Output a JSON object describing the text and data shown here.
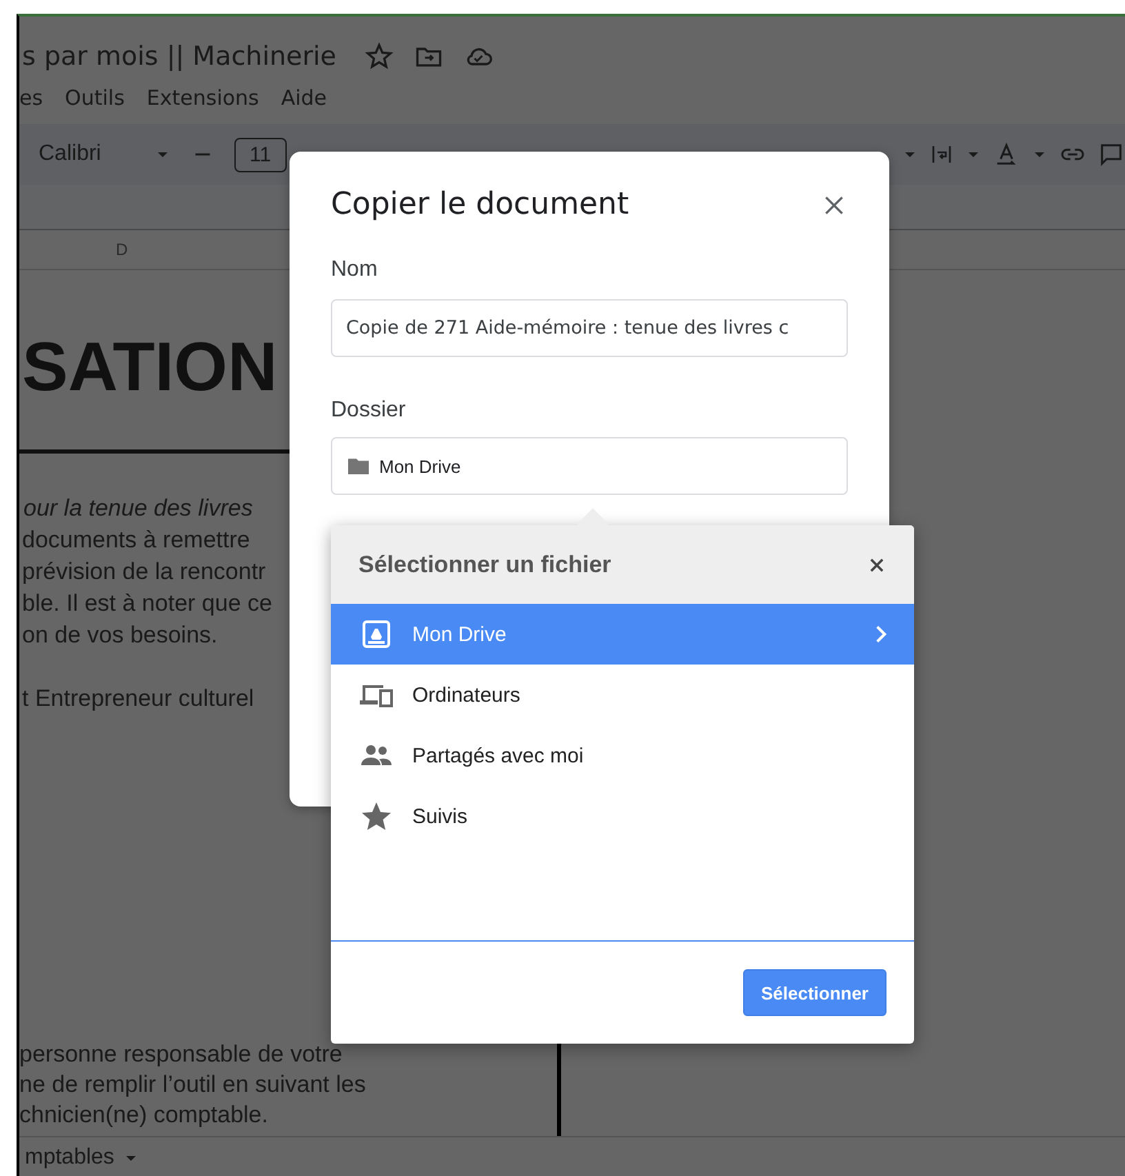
{
  "document": {
    "title": "s par mois || Machinerie",
    "menu": [
      "es",
      "Outils",
      "Extensions",
      "Aide"
    ],
    "toolbar": {
      "font": "Calibri",
      "font_size": "11"
    },
    "column_header": "D",
    "heading": "SATION",
    "lines": [
      {
        "text": "our la tenue des livres",
        "italic": true
      },
      {
        "text": "documents à remettre",
        "italic": false
      },
      {
        "text": "prévision de la rencontr",
        "italic": false
      },
      {
        "text": "ble. Il est à noter que ce",
        "italic": false
      },
      {
        "text": "on de vos besoins.",
        "italic": false
      },
      {
        "text": "t Entrepreneur culturel",
        "italic": false
      }
    ],
    "footer_lines": [
      "personne responsable de votre",
      "ne de remplir l’outil en suivant les",
      "chnicien(ne) comptable."
    ],
    "sheet_tab": "mptables"
  },
  "copy_dialog": {
    "title": "Copier le document",
    "name_label": "Nom",
    "name_value": "Copie de 271 Aide-mémoire : tenue des livres c",
    "folder_label": "Dossier",
    "folder_value": "Mon Drive"
  },
  "file_picker": {
    "title": "Sélectionner un fichier",
    "items": [
      {
        "label": "Mon Drive",
        "kind": "drive",
        "selected": true
      },
      {
        "label": "Ordinateurs",
        "kind": "computers",
        "selected": false
      },
      {
        "label": "Partagés avec moi",
        "kind": "shared",
        "selected": false
      },
      {
        "label": "Suivis",
        "kind": "starred",
        "selected": false
      }
    ],
    "button": "Sélectionner"
  }
}
